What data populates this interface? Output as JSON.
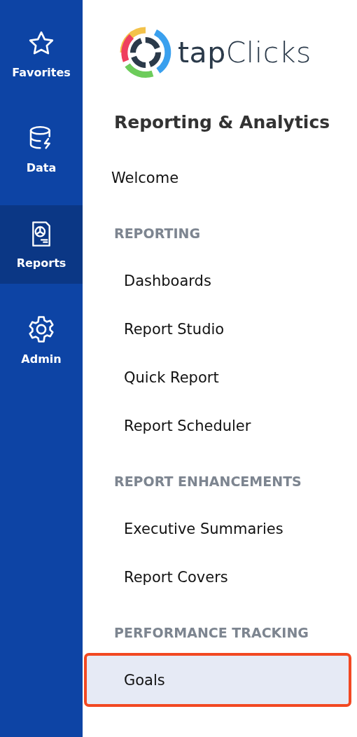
{
  "rail": [
    {
      "label": "Favorites",
      "selected": false
    },
    {
      "label": "Data",
      "selected": false
    },
    {
      "label": "Reports",
      "selected": true
    },
    {
      "label": "Admin",
      "selected": false
    }
  ],
  "logo": {
    "text": "**tap**Clicks"
  },
  "title": "Reporting & Analytics",
  "menu": [
    {
      "kind": "link",
      "label": "Welcome",
      "selected": false
    },
    {
      "kind": "section",
      "label": "REPORTING"
    },
    {
      "kind": "item",
      "label": "Dashboards",
      "selected": false
    },
    {
      "kind": "item",
      "label": "Report Studio",
      "selected": false
    },
    {
      "kind": "item",
      "label": "Quick Report",
      "selected": false
    },
    {
      "kind": "item",
      "label": "Report Scheduler",
      "selected": false
    },
    {
      "kind": "section",
      "label": "REPORT ENHANCEMENTS"
    },
    {
      "kind": "item",
      "label": "Executive Summaries",
      "selected": false
    },
    {
      "kind": "item",
      "label": "Report Covers",
      "selected": false
    },
    {
      "kind": "section",
      "label": "PERFORMANCE TRACKING"
    },
    {
      "kind": "item",
      "label": "Goals",
      "selected": true
    }
  ]
}
